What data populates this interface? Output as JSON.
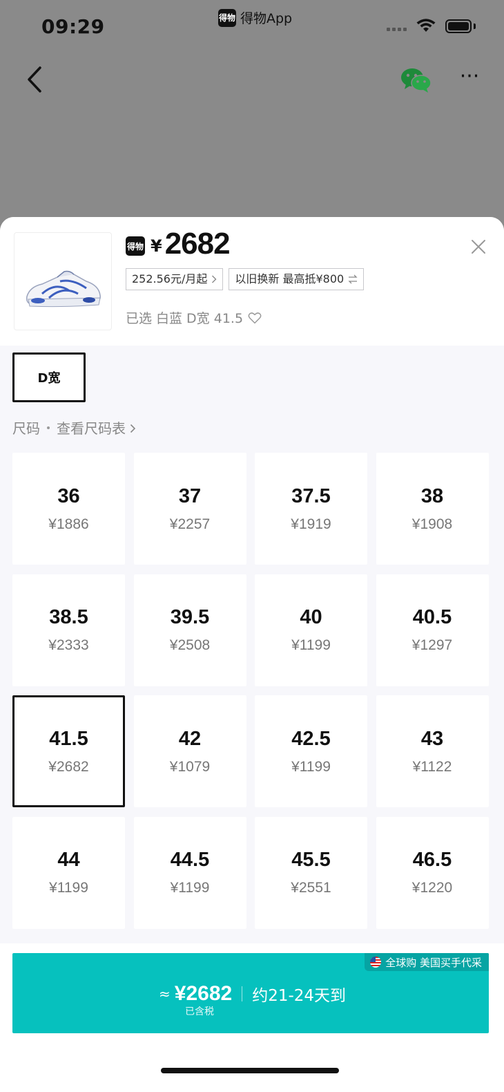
{
  "status_bar": {
    "time": "09:29",
    "app_name": "得物App",
    "app_logo_text": "得物"
  },
  "nav": {
    "back_icon": "chevron-left-icon",
    "share_icon": "wechat-icon",
    "more_label": "···"
  },
  "product": {
    "logo_text": "得物",
    "currency": "¥",
    "price": "2682",
    "installment": "252.56元/月起",
    "trade_in": "以旧换新 最高抵¥800",
    "selected_prefix": "已选",
    "selected_value": "白蓝 D宽 41.5"
  },
  "width_option": {
    "label": "D宽",
    "selected": true
  },
  "size_section": {
    "label": "尺码",
    "chart_link": "查看尺码表"
  },
  "sizes": [
    {
      "size": "36",
      "price": "¥1886"
    },
    {
      "size": "37",
      "price": "¥2257"
    },
    {
      "size": "37.5",
      "price": "¥1919"
    },
    {
      "size": "38",
      "price": "¥1908"
    },
    {
      "size": "38.5",
      "price": "¥2333"
    },
    {
      "size": "39.5",
      "price": "¥2508"
    },
    {
      "size": "40",
      "price": "¥1199"
    },
    {
      "size": "40.5",
      "price": "¥1297"
    },
    {
      "size": "41.5",
      "price": "¥2682",
      "selected": true
    },
    {
      "size": "42",
      "price": "¥1079"
    },
    {
      "size": "42.5",
      "price": "¥1199"
    },
    {
      "size": "43",
      "price": "¥1122"
    },
    {
      "size": "44",
      "price": "¥1199"
    },
    {
      "size": "44.5",
      "price": "¥1199"
    },
    {
      "size": "45.5",
      "price": "¥2551"
    },
    {
      "size": "46.5",
      "price": "¥1220"
    }
  ],
  "buy_button": {
    "badge": "全球购 美国买手代采",
    "approx": "≈",
    "price": "¥2682",
    "delivery": "约21-24天到",
    "tax_note": "已含税",
    "color": "#06c1be"
  }
}
